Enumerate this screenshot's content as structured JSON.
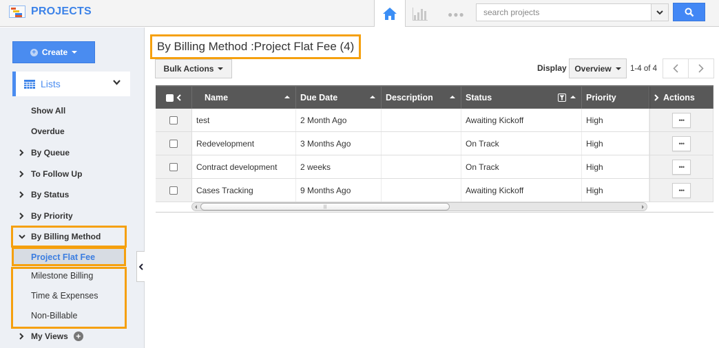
{
  "app": {
    "title": "PROJECTS"
  },
  "topnav": {
    "home_icon": "home-icon",
    "reports_icon": "bar-chart-icon",
    "more_icon": "more-dots-icon",
    "search_placeholder": "search projects",
    "search_value": "",
    "search_button_icon": "search-icon",
    "accent_color": "#4287f5"
  },
  "sidebar": {
    "create_label": "Create",
    "lists_label": "Lists",
    "items": [
      {
        "label": "Show All",
        "type": "plain"
      },
      {
        "label": "Overdue",
        "type": "plain"
      },
      {
        "label": "By Queue",
        "type": "collapsed"
      },
      {
        "label": "To Follow Up",
        "type": "collapsed"
      },
      {
        "label": "By Status",
        "type": "collapsed"
      },
      {
        "label": "By Priority",
        "type": "collapsed"
      },
      {
        "label": "By Billing Method",
        "type": "expanded"
      }
    ],
    "billing_sub_items": [
      {
        "label": "Project Flat Fee",
        "active": true
      },
      {
        "label": "Milestone Billing",
        "active": false
      },
      {
        "label": "Time & Expenses",
        "active": false
      },
      {
        "label": "Non-Billable",
        "active": false
      }
    ],
    "my_views_label": "My Views",
    "highlight_color": "#f5a00e"
  },
  "main": {
    "title": "By Billing Method :Project Flat Fee (4)",
    "bulk_actions_label": "Bulk Actions",
    "display_label": "Display",
    "display_value": "Overview",
    "range_label": "1-4 of 4",
    "table": {
      "columns": [
        "Name",
        "Due Date",
        "Description",
        "Status",
        "Priority",
        "Actions"
      ],
      "rows": [
        {
          "name": "test",
          "due_date": "2 Month Ago",
          "description": "",
          "status": "Awaiting Kickoff",
          "priority": "High"
        },
        {
          "name": "Redevelopment",
          "due_date": "3 Months Ago",
          "description": "",
          "status": "On Track",
          "priority": "High"
        },
        {
          "name": "Contract development",
          "due_date": "2 weeks",
          "description": "",
          "status": "On Track",
          "priority": "High"
        },
        {
          "name": "Cases Tracking",
          "due_date": "9 Months Ago",
          "description": "",
          "status": "Awaiting Kickoff",
          "priority": "High"
        }
      ],
      "row_action_label": "•••"
    }
  }
}
